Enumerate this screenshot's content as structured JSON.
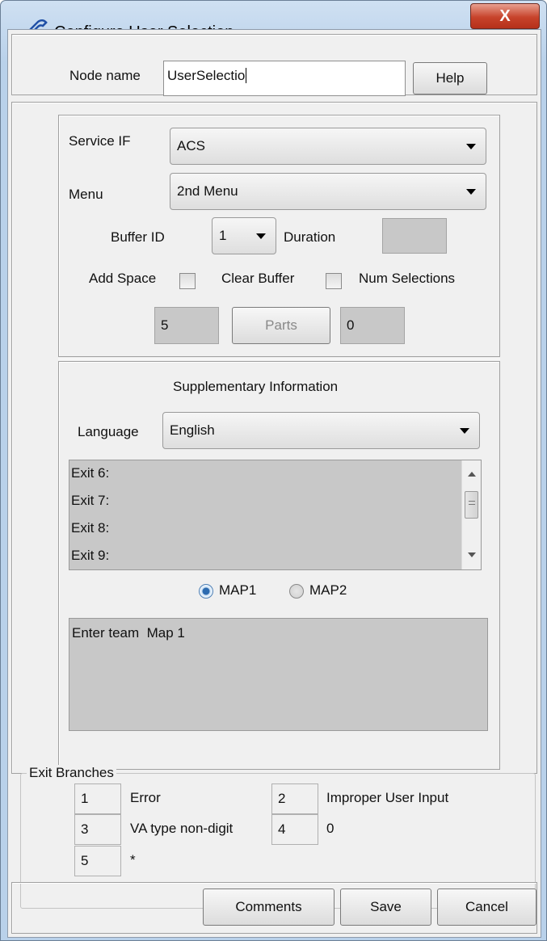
{
  "window": {
    "title": "Configure User Selection",
    "close_label": "X"
  },
  "node": {
    "label": "Node name",
    "value": "UserSelectio",
    "help_label": "Help"
  },
  "service_if": {
    "label": "Service IF",
    "value": "ACS"
  },
  "menu": {
    "label": "Menu",
    "value": "2nd Menu"
  },
  "buffer": {
    "label": "Buffer ID",
    "value": "1",
    "duration_label": "Duration",
    "duration_value": ""
  },
  "options": {
    "add_space_label": "Add Space",
    "clear_buffer_label": "Clear Buffer",
    "num_selections_label": "Num Selections"
  },
  "parts": {
    "left_value": "5",
    "button_label": "Parts",
    "right_value": "0"
  },
  "supplementary": {
    "title": "Supplementary Information",
    "language_label": "Language",
    "language_value": "English",
    "exits": [
      "Exit 6:",
      "Exit 7:",
      "Exit 8:",
      "Exit 9:"
    ],
    "map1_label": "MAP1",
    "map2_label": "MAP2",
    "selected_map": "MAP1",
    "map_text": "Enter team  Map 1"
  },
  "exit_branches": {
    "title": "Exit Branches",
    "items": [
      {
        "num": "1",
        "label": "Error"
      },
      {
        "num": "2",
        "label": "Improper User Input"
      },
      {
        "num": "3",
        "label": "VA type non-digit"
      },
      {
        "num": "4",
        "label": "0"
      },
      {
        "num": "5",
        "label": "*"
      }
    ]
  },
  "footer": {
    "comments_label": "Comments",
    "save_label": "Save",
    "cancel_label": "Cancel"
  }
}
